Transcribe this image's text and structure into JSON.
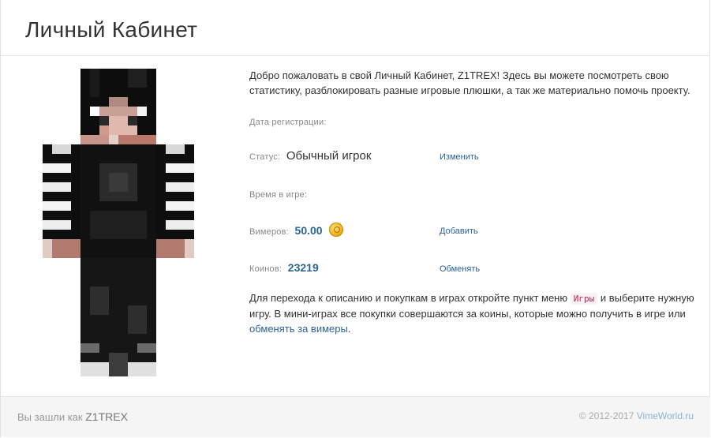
{
  "header": {
    "title": "Личный Кабинет"
  },
  "profile": {
    "intro": "Добро пожаловать в свой Личный Кабинет, Z1TREX! Здесь вы можете посмотреть свою статистику, разблокировать разные игровые плюшки, а так же материально помочь проекту.",
    "registration_label": "Дата регистрации:",
    "registration_value": "",
    "status_label": "Статус:",
    "status_value": "Обычный игрок",
    "status_action": "Изменить",
    "playtime_label": "Время в игре:",
    "playtime_value": "",
    "vimers_label": "Вимеров:",
    "vimers_value": "50.00",
    "vimers_action": "Добавить",
    "coins_label": "Коинов:",
    "coins_value": "23219",
    "coins_action": "Обменять",
    "note_part1": "Для перехода к описанию и покупкам в играх откройте пункт меню",
    "note_tag": "Игры",
    "note_part2": "и выберите нужную игру. В мини-играх все покупки совершаются за коины, которые можно получить в игре или",
    "note_link": "обменять за вимеры",
    "note_end": "."
  },
  "footer": {
    "login_prefix": "Вы зашли как",
    "username": "Z1TREX",
    "copyright": "© 2012-2017",
    "site": "VimeWorld.ru"
  },
  "colors": {
    "link": "#2a6496",
    "tag_text": "#c7254e",
    "tag_bg": "#f9f2f4",
    "footer_bg": "#f5f5f5",
    "coin": "#f2b518"
  },
  "icons": {
    "coin": "coin-icon",
    "avatar": "minecraft-skin"
  }
}
